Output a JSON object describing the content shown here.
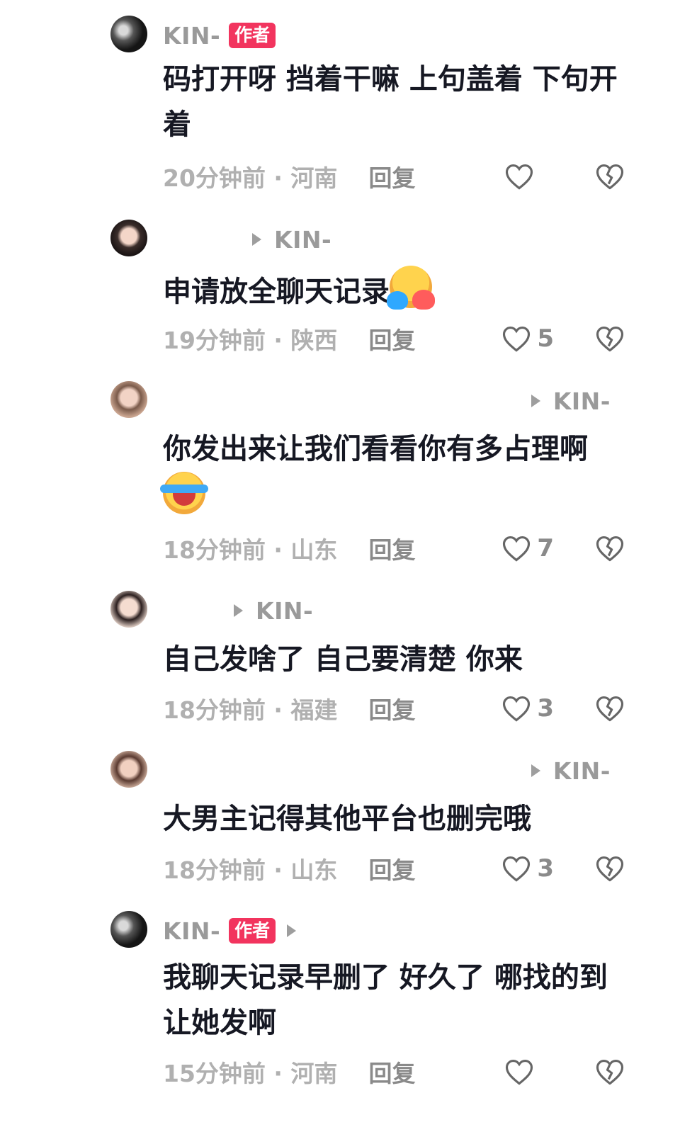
{
  "author_badge": "作者",
  "reply_label": "回复",
  "comments": [
    {
      "user": "KIN-",
      "reply_to": "",
      "content": "码打开呀 挡着干嘛  上句盖着 下句开着",
      "emoji": "",
      "time": "20分钟前 · 河南",
      "likes": ""
    },
    {
      "user": "",
      "reply_to": "KIN-",
      "content": "申请放全聊天记录",
      "emoji": "smiling-face-with-open-hands",
      "time": "19分钟前 · 陕西",
      "likes": "5"
    },
    {
      "user": "",
      "reply_to": "KIN-",
      "content": "你发出来让我们看看你有多占理啊",
      "emoji": "loudly-crying-face",
      "time": "18分钟前 · 山东",
      "likes": "7"
    },
    {
      "user": "",
      "reply_to": "KIN-",
      "content": "自己发啥了 自己要清楚 你来",
      "emoji": "",
      "time": "18分钟前 · 福建",
      "likes": "3"
    },
    {
      "user": "",
      "reply_to": "KIN-",
      "content": "大男主记得其他平台也删完哦",
      "emoji": "",
      "time": "18分钟前 · 山东",
      "likes": "3"
    },
    {
      "user": "KIN-",
      "reply_to": "",
      "content": "我聊天记录早删了 好久了 哪找的到让她发啊",
      "emoji": "",
      "time": "15分钟前 · 河南",
      "likes": ""
    }
  ],
  "colors": {
    "badge": "#f2345e",
    "username": "#9a9a9a",
    "content": "#161823",
    "meta": "#b0b0b0"
  },
  "icons": [
    "heart-outline-icon",
    "broken-heart-icon",
    "play-arrow-icon"
  ]
}
